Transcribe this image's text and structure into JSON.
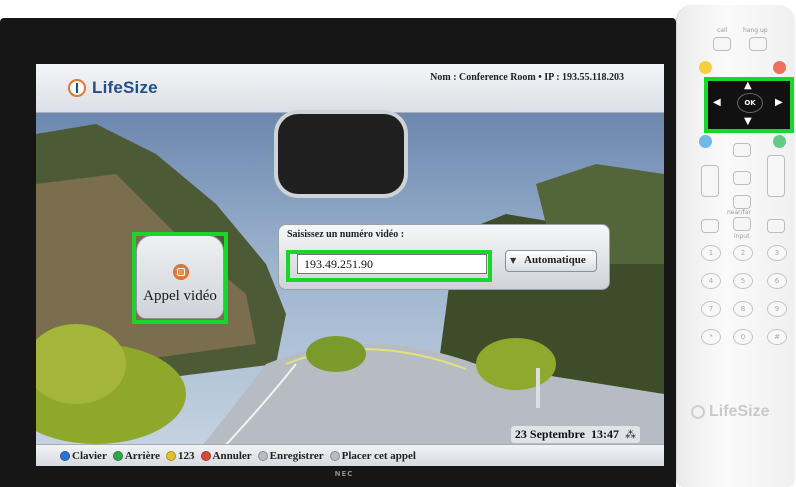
{
  "tv": {
    "brand": "NEC"
  },
  "header": {
    "logo_text": "LifeSize",
    "info": "Nom : Conference Room • IP : 193.55.118.203"
  },
  "call_button": {
    "label": "Appel vidéo",
    "icon": "video-call-icon"
  },
  "dial": {
    "title": "Saisissez un numéro vidéo :",
    "value": "193.49.251.90",
    "mode": "Automatique"
  },
  "status": {
    "date": "23 Septembre",
    "time": "13:47",
    "icon": "network-icon"
  },
  "softkeys": [
    {
      "color": "#2f6fd6",
      "label": "Clavier"
    },
    {
      "color": "#2fa84a",
      "label": "Arrière"
    },
    {
      "color": "#e2c22a",
      "label": "123"
    },
    {
      "color": "#d84a3a",
      "label": "Annuler"
    },
    {
      "color": "#b8bcc2",
      "label": "Enregistrer"
    },
    {
      "color": "#b8bcc2",
      "label": "Placer cet appel"
    }
  ],
  "remote": {
    "top_labels": {
      "call": "call",
      "hangup": "hang up"
    },
    "ok_label": "OK",
    "mid_labels": {
      "near_far": "near/far",
      "input": "input"
    },
    "keys": [
      "1",
      "2",
      "3",
      "4",
      "5",
      "6",
      "7",
      "8",
      "9",
      "*",
      "0",
      "#"
    ],
    "logo_text": "LifeSize",
    "colors": {
      "yellow": "#f3cf3a",
      "red": "#ef6e5e",
      "blue": "#6fb8e8",
      "green": "#66c98a"
    }
  },
  "highlight_color": "#19d62a"
}
